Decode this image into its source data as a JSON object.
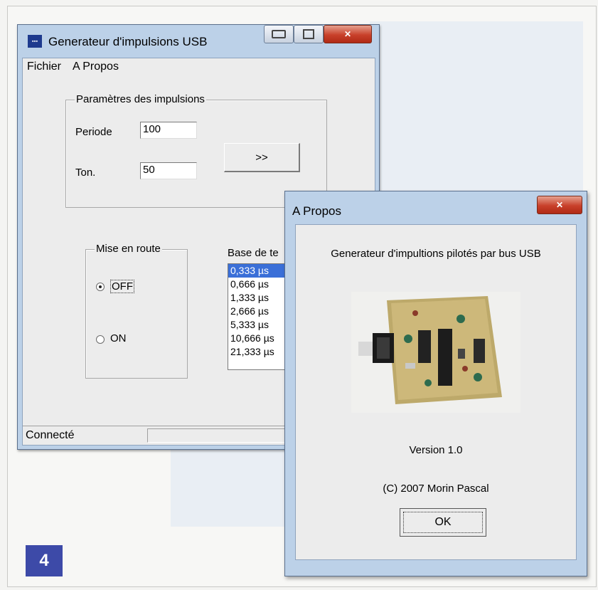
{
  "figure_number": "4",
  "main_window": {
    "title": "Generateur d'impulsions USB",
    "app_icon_text": "ꞏꞏꞏ",
    "menu": {
      "fichier": "Fichier",
      "apropos": "A Propos"
    },
    "params_group": {
      "label": "Paramètres des impulsions",
      "periode_label": "Periode",
      "periode_value": "100",
      "ton_label": "Ton.",
      "ton_value": "50",
      "apply_button": ">>"
    },
    "mise_en_route": {
      "label": "Mise en route",
      "off_label": "OFF",
      "on_label": "ON",
      "selected": "OFF"
    },
    "base_de_temps": {
      "label": "Base de te",
      "items": [
        "0,333 µs",
        "0,666 µs",
        "1,333 µs",
        "2,666 µs",
        "5,333 µs",
        "10,666 µs",
        "21,333 µs"
      ],
      "selected_index": 0
    },
    "status": "Connecté"
  },
  "about_dialog": {
    "title": "A Propos",
    "description": "Generateur d'impultions pilotés par bus USB",
    "version": "Version 1.0",
    "copyright": "(C) 2007 Morin Pascal",
    "ok_button": "OK"
  },
  "colors": {
    "window_frame": "#bcd1e8",
    "close_button": "#c8402a",
    "list_selection": "#3a6fd8",
    "figure_badge": "#3d4aa8"
  }
}
